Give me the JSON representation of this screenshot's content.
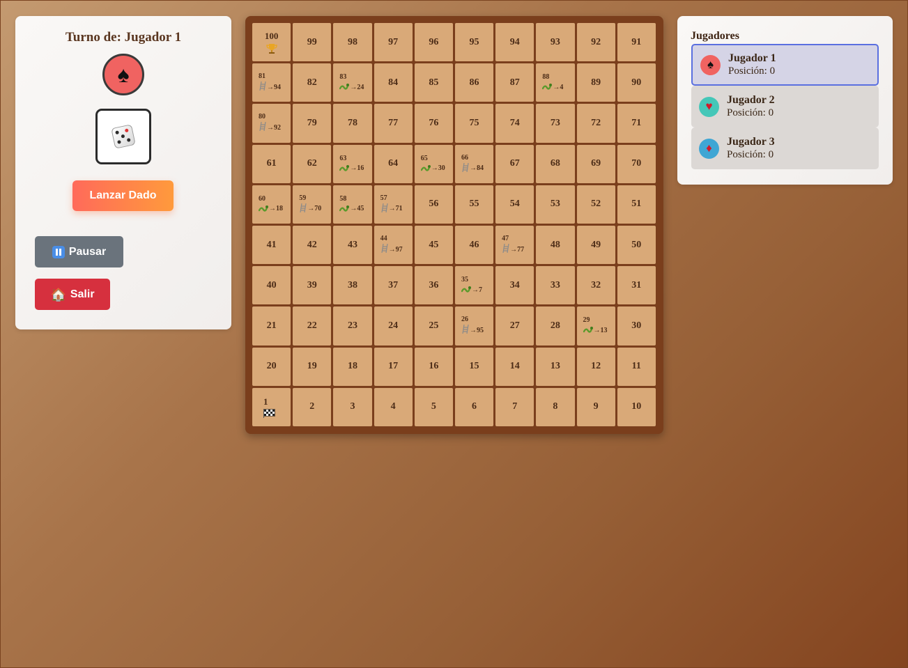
{
  "turn": {
    "label": "Turno de: Jugador 1",
    "token_icon": "spade-icon",
    "token_color": "#f06361"
  },
  "dice": {
    "icon": "dice-icon"
  },
  "buttons": {
    "roll": "Lanzar Dado",
    "pause": "Pausar",
    "exit": "Salir"
  },
  "board": {
    "rows": [
      [
        {
          "n": "100",
          "icon": "trophy"
        },
        {
          "n": "99"
        },
        {
          "n": "98"
        },
        {
          "n": "97"
        },
        {
          "n": "96"
        },
        {
          "n": "95"
        },
        {
          "n": "94"
        },
        {
          "n": "93"
        },
        {
          "n": "92"
        },
        {
          "n": "91"
        }
      ],
      [
        {
          "n": "81",
          "kind": "ladder",
          "to": "→94"
        },
        {
          "n": "82"
        },
        {
          "n": "83",
          "kind": "snake",
          "to": "→24"
        },
        {
          "n": "84"
        },
        {
          "n": "85"
        },
        {
          "n": "86"
        },
        {
          "n": "87"
        },
        {
          "n": "88",
          "kind": "snake",
          "to": "→4"
        },
        {
          "n": "89"
        },
        {
          "n": "90"
        }
      ],
      [
        {
          "n": "80",
          "kind": "ladder",
          "to": "→92"
        },
        {
          "n": "79"
        },
        {
          "n": "78"
        },
        {
          "n": "77"
        },
        {
          "n": "76"
        },
        {
          "n": "75"
        },
        {
          "n": "74"
        },
        {
          "n": "73"
        },
        {
          "n": "72"
        },
        {
          "n": "71"
        }
      ],
      [
        {
          "n": "61"
        },
        {
          "n": "62"
        },
        {
          "n": "63",
          "kind": "snake",
          "to": "→16"
        },
        {
          "n": "64"
        },
        {
          "n": "65",
          "kind": "snake",
          "to": "→30"
        },
        {
          "n": "66",
          "kind": "ladder",
          "to": "→84"
        },
        {
          "n": "67"
        },
        {
          "n": "68"
        },
        {
          "n": "69"
        },
        {
          "n": "70"
        }
      ],
      [
        {
          "n": "60",
          "kind": "snake",
          "to": "→18"
        },
        {
          "n": "59",
          "kind": "ladder",
          "to": "→70"
        },
        {
          "n": "58",
          "kind": "snake",
          "to": "→45"
        },
        {
          "n": "57",
          "kind": "ladder",
          "to": "→71"
        },
        {
          "n": "56"
        },
        {
          "n": "55"
        },
        {
          "n": "54"
        },
        {
          "n": "53"
        },
        {
          "n": "52"
        },
        {
          "n": "51"
        }
      ],
      [
        {
          "n": "41"
        },
        {
          "n": "42"
        },
        {
          "n": "43"
        },
        {
          "n": "44",
          "kind": "ladder",
          "to": "→97"
        },
        {
          "n": "45"
        },
        {
          "n": "46"
        },
        {
          "n": "47",
          "kind": "ladder",
          "to": "→77"
        },
        {
          "n": "48"
        },
        {
          "n": "49"
        },
        {
          "n": "50"
        }
      ],
      [
        {
          "n": "40"
        },
        {
          "n": "39"
        },
        {
          "n": "38"
        },
        {
          "n": "37"
        },
        {
          "n": "36"
        },
        {
          "n": "35",
          "kind": "snake",
          "to": "→7"
        },
        {
          "n": "34"
        },
        {
          "n": "33"
        },
        {
          "n": "32"
        },
        {
          "n": "31"
        }
      ],
      [
        {
          "n": "21"
        },
        {
          "n": "22"
        },
        {
          "n": "23"
        },
        {
          "n": "24"
        },
        {
          "n": "25"
        },
        {
          "n": "26",
          "kind": "ladder",
          "to": "→95"
        },
        {
          "n": "27"
        },
        {
          "n": "28"
        },
        {
          "n": "29",
          "kind": "snake",
          "to": "→13"
        },
        {
          "n": "30"
        }
      ],
      [
        {
          "n": "20"
        },
        {
          "n": "19"
        },
        {
          "n": "18"
        },
        {
          "n": "17"
        },
        {
          "n": "16"
        },
        {
          "n": "15"
        },
        {
          "n": "14"
        },
        {
          "n": "13"
        },
        {
          "n": "12"
        },
        {
          "n": "11"
        }
      ],
      [
        {
          "n": "1",
          "icon": "flag"
        },
        {
          "n": "2"
        },
        {
          "n": "3"
        },
        {
          "n": "4"
        },
        {
          "n": "5"
        },
        {
          "n": "6"
        },
        {
          "n": "7"
        },
        {
          "n": "8"
        },
        {
          "n": "9"
        },
        {
          "n": "10"
        }
      ]
    ]
  },
  "players": {
    "title": "Jugadores",
    "list": [
      {
        "name": "Jugador 1",
        "position": "Posición: 0",
        "suit": "♠",
        "icon": "spade-icon",
        "color": "#f06361",
        "active": true
      },
      {
        "name": "Jugador 2",
        "position": "Posición: 0",
        "suit": "♥",
        "icon": "heart-icon",
        "color": "#45c7b8",
        "active": false
      },
      {
        "name": "Jugador 3",
        "position": "Posición: 0",
        "suit": "♦",
        "icon": "diamond-icon",
        "color": "#3fa6d4",
        "active": false
      }
    ]
  }
}
